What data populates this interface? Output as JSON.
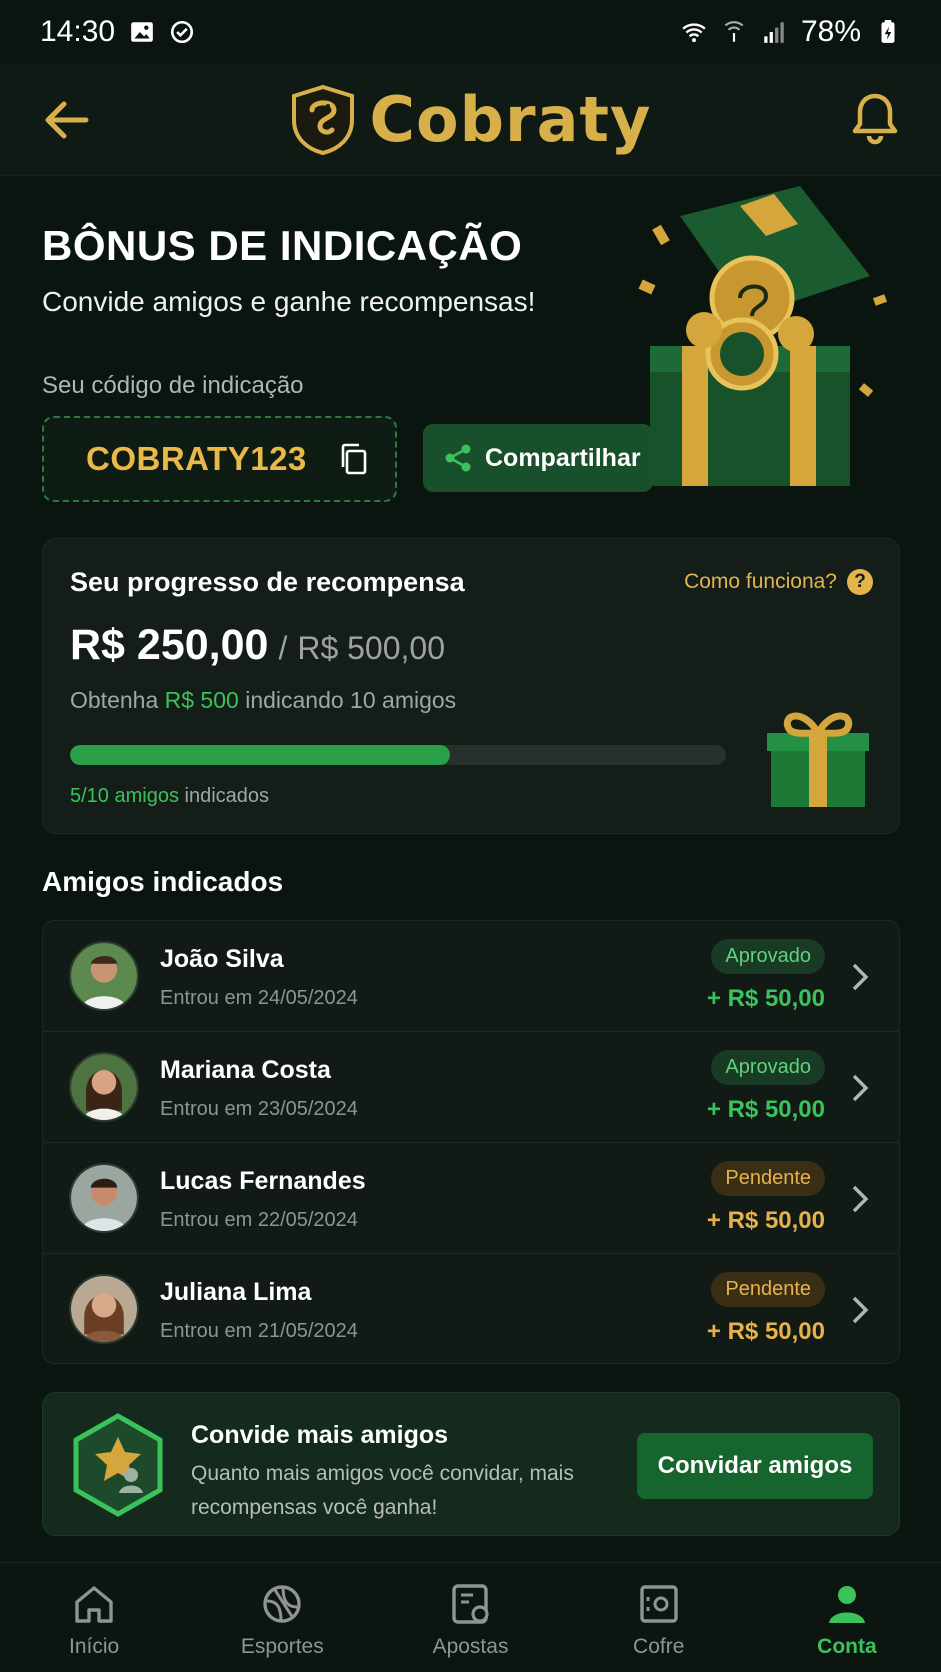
{
  "status_bar": {
    "time": "14:30",
    "battery": "78%"
  },
  "header": {
    "brand": "Cobraty"
  },
  "hero": {
    "title": "BÔNUS DE INDICAÇÃO",
    "subtitle": "Convide amigos e ganhe recompensas!",
    "code_label": "Seu código de indicação",
    "code": "COBRATY123",
    "share_label": "Compartilhar"
  },
  "progress": {
    "title": "Seu progresso de recompensa",
    "help_label": "Como funciona?",
    "current": "R$ 250,00",
    "separator": "/",
    "target": "R$ 500,00",
    "desc_prefix": "Obtenha",
    "desc_amount": "R$ 500",
    "desc_suffix": "indicando 10 amigos",
    "count_highlight": "5/10 amigos",
    "count_suffix": "indicados",
    "fraction": 0.58
  },
  "friends": {
    "title": "Amigos indicados",
    "items": [
      {
        "name": "João Silva",
        "date": "Entrou em 24/05/2024",
        "status": "Aprovado",
        "reward": "+ R$ 50,00"
      },
      {
        "name": "Mariana Costa",
        "date": "Entrou em 23/05/2024",
        "status": "Aprovado",
        "reward": "+ R$ 50,00"
      },
      {
        "name": "Lucas Fernandes",
        "date": "Entrou em 22/05/2024",
        "status": "Pendente",
        "reward": "+ R$ 50,00"
      },
      {
        "name": "Juliana Lima",
        "date": "Entrou em 21/05/2024",
        "status": "Pendente",
        "reward": "+ R$ 50,00"
      }
    ]
  },
  "invite": {
    "title": "Convide mais amigos",
    "text": "Quanto mais amigos você convidar, mais recompensas você ganha!",
    "button": "Convidar amigos"
  },
  "nav": {
    "items": [
      {
        "label": "Início",
        "icon": "home-icon"
      },
      {
        "label": "Esportes",
        "icon": "sports-ball-icon"
      },
      {
        "label": "Apostas",
        "icon": "bets-ticket-icon"
      },
      {
        "label": "Cofre",
        "icon": "safe-icon"
      },
      {
        "label": "Conta",
        "icon": "account-icon"
      }
    ],
    "active": "Conta"
  },
  "colors": {
    "accent_gold": "#d8b04a",
    "accent_green": "#3bc25b",
    "background": "#0b1510"
  }
}
